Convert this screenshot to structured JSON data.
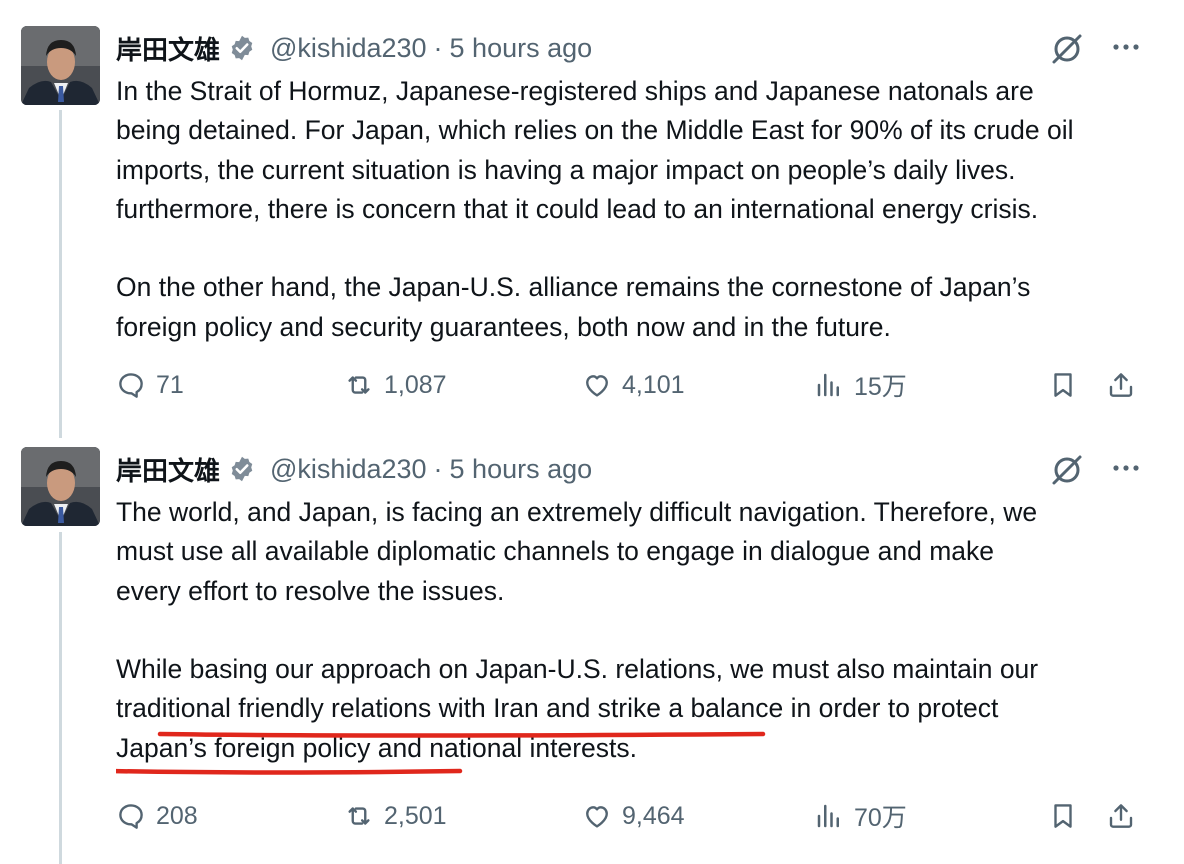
{
  "colors": {
    "accent_blue": "#1d9bf0",
    "muted": "#536471",
    "text": "#0f1419",
    "annotation_red": "#e0271c"
  },
  "tweets": [
    {
      "author_name": "岸田文雄",
      "handle": "@kishida230",
      "separator": "·",
      "time": "5 hours ago",
      "lines": [
        "In the Strait of Hormuz, Japanese-registered ships and Japanese natonals are",
        "being detained. For Japan, which relies on the Middle East for 90% of its crude oil",
        "imports, the current situation is having a major impact on people’s daily lives.",
        "furthermore, there is concern that it could lead to an international energy crisis.",
        "",
        "On the other hand, the Japan-U.S. alliance remains the cornestone of Japan’s",
        "foreign policy and security guarantees, both now and in the future."
      ],
      "replies": "71",
      "reposts": "1,087",
      "likes": "4,101",
      "views": "15万"
    },
    {
      "author_name": "岸田文雄",
      "handle": "@kishida230",
      "separator": "·",
      "time": "5 hours ago",
      "lines": [
        "The world, and Japan, is facing an extremely difficult navigation. Therefore, we",
        "must use all available diplomatic channels to engage in dialogue and make",
        "every effort to resolve the issues.",
        "",
        "While basing our approach on Japan-U.S. relations, we must also maintain our",
        "traditional friendly relations with Iran and strike a balance in order to protect",
        "Japan’s foreign policy and national interests."
      ],
      "highlight_1": {
        "pre": "While ",
        "mark": "basing our approach on Japan-U.S. relations",
        "post": ", we must also maintain our"
      },
      "highlight_2": {
        "mark": "traditional friendly relations",
        "post": " with Iran and strike a balance in order to protect"
      },
      "replies": "208",
      "reposts": "2,501",
      "likes": "9,464",
      "views": "70万"
    }
  ],
  "icons": {
    "verified": "verified-badge-icon",
    "grok": "grok-icon",
    "more": "more-icon",
    "reply": "reply-icon",
    "repost": "repost-icon",
    "like": "like-icon",
    "views": "views-icon",
    "bookmark": "bookmark-icon",
    "share": "share-icon"
  }
}
